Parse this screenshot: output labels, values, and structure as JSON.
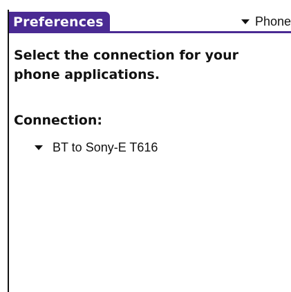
{
  "app": {
    "title": "Preferences"
  },
  "header": {
    "category_picker": {
      "selected": "Phone",
      "icon": "triangle-down-icon"
    }
  },
  "main": {
    "instructions": "Select the connection for your phone applications.",
    "connection_label": "Connection:",
    "connection_picker": {
      "selected": "BT to Sony-E T616",
      "icon": "triangle-down-icon"
    }
  },
  "colors": {
    "title_bar": "#4a2a93",
    "background": "#ffffff",
    "text": "#111111"
  }
}
